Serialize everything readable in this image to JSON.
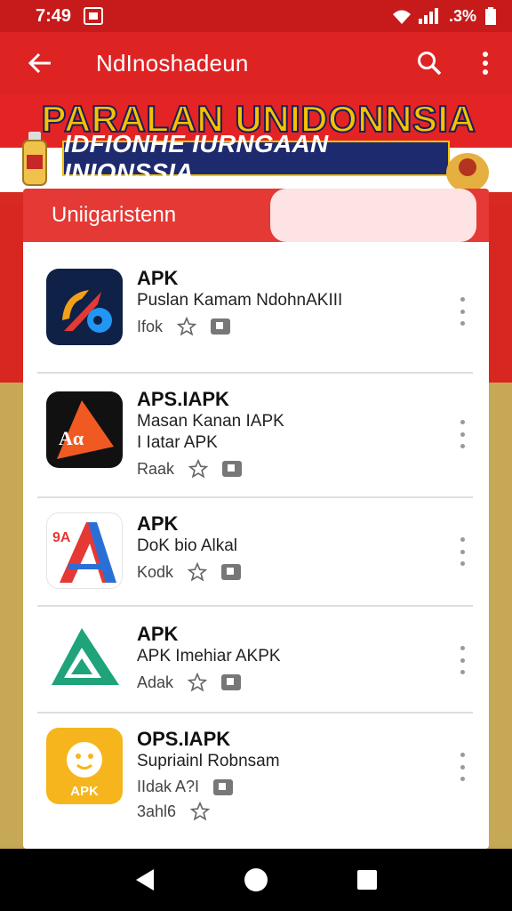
{
  "status_bar": {
    "time": "7:49",
    "battery_text": ".3%"
  },
  "app_bar": {
    "title": "NdInoshadeun"
  },
  "banner": {
    "title": "PARALAN UNIDONNSIA",
    "subtitle": "IDFIONHE IURNGAAN INIONSSIA"
  },
  "card": {
    "header_label": "Uniigaristenn",
    "items": [
      {
        "name": "APK",
        "lines": [
          "Puslan Kamam NdohnAKIII"
        ],
        "meta": "Ifok",
        "extra": ""
      },
      {
        "name": "APS.IAPK",
        "lines": [
          "Masan Kanan IAPK",
          "I Iatar APK"
        ],
        "meta": "Raak",
        "extra": ""
      },
      {
        "name": "APK",
        "lines": [
          "DoK bio Alkal"
        ],
        "meta": "Kodk",
        "extra": ""
      },
      {
        "name": "APK",
        "lines": [
          "APK Imehiar AKPK"
        ],
        "meta": "Adak",
        "extra": ""
      },
      {
        "name": "OPS.IAPK",
        "lines": [
          "Supriainl Robnsam"
        ],
        "meta": "IIdak A?I",
        "extra": "3ahl6"
      }
    ],
    "icon_labels": {
      "item1": "",
      "item2": "Aα",
      "item3": "9A",
      "item5": "APK"
    }
  },
  "colors": {
    "primary": "#de2323",
    "header": "#e53935",
    "gold": "#f5c200",
    "navy": "#1e2a6e"
  },
  "icons": [
    "back-arrow-icon",
    "search-icon",
    "more-vert-icon",
    "star-icon",
    "tag-icon",
    "nav-back-icon",
    "nav-home-icon",
    "nav-recents-icon"
  ]
}
